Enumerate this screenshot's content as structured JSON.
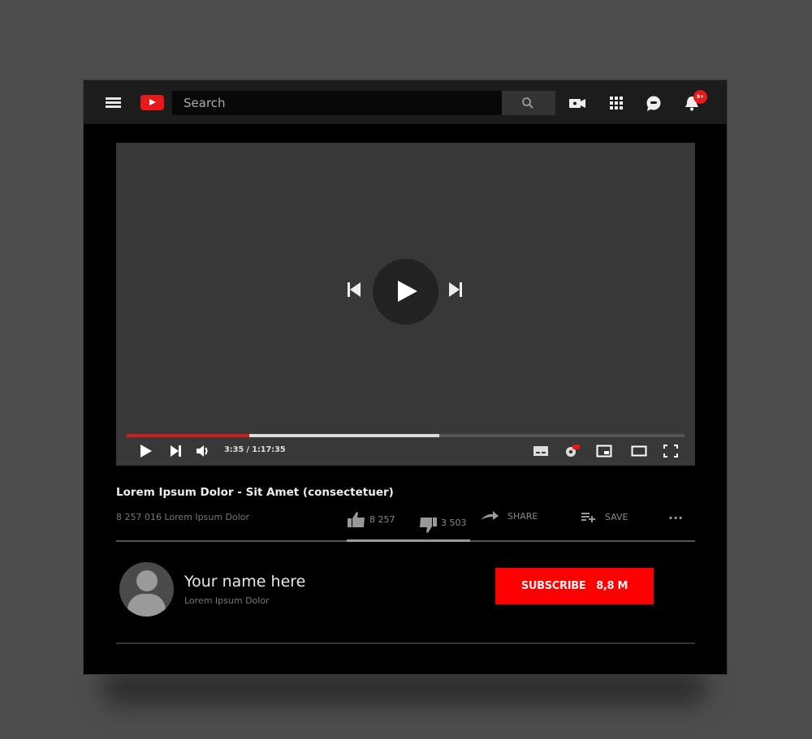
{
  "header": {
    "search_placeholder": "Search",
    "notification_count": "9+",
    "icons": [
      "menu-icon",
      "youtube-logo",
      "search-icon",
      "create-video-icon",
      "apps-grid-icon",
      "messages-icon",
      "notifications-bell-icon"
    ]
  },
  "player": {
    "current_time": "3:35",
    "duration": "1:17:35",
    "time_display": "3:35 / 1:17:35",
    "played_fraction": 0.22,
    "buffered_fraction": 0.56,
    "accent_color": "#d11d1d"
  },
  "video": {
    "title": "Lorem Ipsum Dolor - Sit Amet (consectetuer)",
    "views": "8 257 016 Lorem Ipsum Dolor",
    "likes": "8 257",
    "dislikes": "3 503",
    "share_label": "SHARE",
    "save_label": "SAVE",
    "more_label": "···"
  },
  "channel": {
    "name": "Your name here",
    "subtitle": "Lorem Ipsum Dolor",
    "subscribe_label": "SUBSCRIBE",
    "subscriber_count": "8,8 M",
    "subscribe_color": "#ff0000"
  }
}
